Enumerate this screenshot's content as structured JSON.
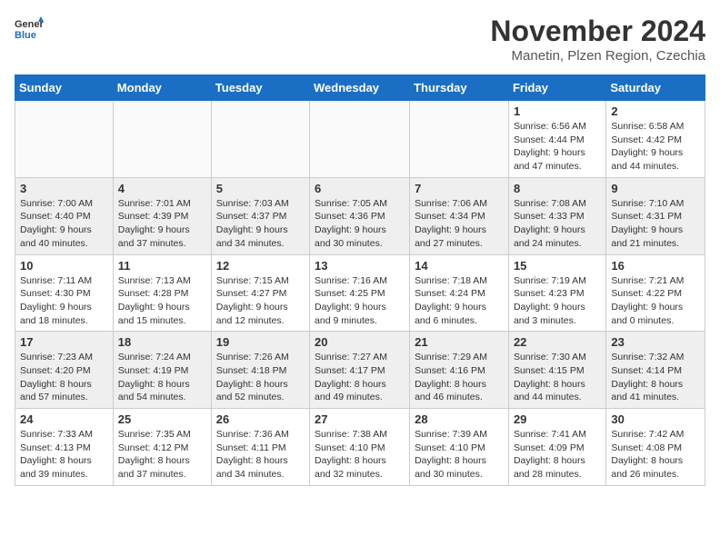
{
  "header": {
    "logo_line1": "General",
    "logo_line2": "Blue",
    "month_title": "November 2024",
    "subtitle": "Manetin, Plzen Region, Czechia"
  },
  "weekdays": [
    "Sunday",
    "Monday",
    "Tuesday",
    "Wednesday",
    "Thursday",
    "Friday",
    "Saturday"
  ],
  "weeks": [
    [
      {
        "day": "",
        "info": ""
      },
      {
        "day": "",
        "info": ""
      },
      {
        "day": "",
        "info": ""
      },
      {
        "day": "",
        "info": ""
      },
      {
        "day": "",
        "info": ""
      },
      {
        "day": "1",
        "info": "Sunrise: 6:56 AM\nSunset: 4:44 PM\nDaylight: 9 hours\nand 47 minutes."
      },
      {
        "day": "2",
        "info": "Sunrise: 6:58 AM\nSunset: 4:42 PM\nDaylight: 9 hours\nand 44 minutes."
      }
    ],
    [
      {
        "day": "3",
        "info": "Sunrise: 7:00 AM\nSunset: 4:40 PM\nDaylight: 9 hours\nand 40 minutes."
      },
      {
        "day": "4",
        "info": "Sunrise: 7:01 AM\nSunset: 4:39 PM\nDaylight: 9 hours\nand 37 minutes."
      },
      {
        "day": "5",
        "info": "Sunrise: 7:03 AM\nSunset: 4:37 PM\nDaylight: 9 hours\nand 34 minutes."
      },
      {
        "day": "6",
        "info": "Sunrise: 7:05 AM\nSunset: 4:36 PM\nDaylight: 9 hours\nand 30 minutes."
      },
      {
        "day": "7",
        "info": "Sunrise: 7:06 AM\nSunset: 4:34 PM\nDaylight: 9 hours\nand 27 minutes."
      },
      {
        "day": "8",
        "info": "Sunrise: 7:08 AM\nSunset: 4:33 PM\nDaylight: 9 hours\nand 24 minutes."
      },
      {
        "day": "9",
        "info": "Sunrise: 7:10 AM\nSunset: 4:31 PM\nDaylight: 9 hours\nand 21 minutes."
      }
    ],
    [
      {
        "day": "10",
        "info": "Sunrise: 7:11 AM\nSunset: 4:30 PM\nDaylight: 9 hours\nand 18 minutes."
      },
      {
        "day": "11",
        "info": "Sunrise: 7:13 AM\nSunset: 4:28 PM\nDaylight: 9 hours\nand 15 minutes."
      },
      {
        "day": "12",
        "info": "Sunrise: 7:15 AM\nSunset: 4:27 PM\nDaylight: 9 hours\nand 12 minutes."
      },
      {
        "day": "13",
        "info": "Sunrise: 7:16 AM\nSunset: 4:25 PM\nDaylight: 9 hours\nand 9 minutes."
      },
      {
        "day": "14",
        "info": "Sunrise: 7:18 AM\nSunset: 4:24 PM\nDaylight: 9 hours\nand 6 minutes."
      },
      {
        "day": "15",
        "info": "Sunrise: 7:19 AM\nSunset: 4:23 PM\nDaylight: 9 hours\nand 3 minutes."
      },
      {
        "day": "16",
        "info": "Sunrise: 7:21 AM\nSunset: 4:22 PM\nDaylight: 9 hours\nand 0 minutes."
      }
    ],
    [
      {
        "day": "17",
        "info": "Sunrise: 7:23 AM\nSunset: 4:20 PM\nDaylight: 8 hours\nand 57 minutes."
      },
      {
        "day": "18",
        "info": "Sunrise: 7:24 AM\nSunset: 4:19 PM\nDaylight: 8 hours\nand 54 minutes."
      },
      {
        "day": "19",
        "info": "Sunrise: 7:26 AM\nSunset: 4:18 PM\nDaylight: 8 hours\nand 52 minutes."
      },
      {
        "day": "20",
        "info": "Sunrise: 7:27 AM\nSunset: 4:17 PM\nDaylight: 8 hours\nand 49 minutes."
      },
      {
        "day": "21",
        "info": "Sunrise: 7:29 AM\nSunset: 4:16 PM\nDaylight: 8 hours\nand 46 minutes."
      },
      {
        "day": "22",
        "info": "Sunrise: 7:30 AM\nSunset: 4:15 PM\nDaylight: 8 hours\nand 44 minutes."
      },
      {
        "day": "23",
        "info": "Sunrise: 7:32 AM\nSunset: 4:14 PM\nDaylight: 8 hours\nand 41 minutes."
      }
    ],
    [
      {
        "day": "24",
        "info": "Sunrise: 7:33 AM\nSunset: 4:13 PM\nDaylight: 8 hours\nand 39 minutes."
      },
      {
        "day": "25",
        "info": "Sunrise: 7:35 AM\nSunset: 4:12 PM\nDaylight: 8 hours\nand 37 minutes."
      },
      {
        "day": "26",
        "info": "Sunrise: 7:36 AM\nSunset: 4:11 PM\nDaylight: 8 hours\nand 34 minutes."
      },
      {
        "day": "27",
        "info": "Sunrise: 7:38 AM\nSunset: 4:10 PM\nDaylight: 8 hours\nand 32 minutes."
      },
      {
        "day": "28",
        "info": "Sunrise: 7:39 AM\nSunset: 4:10 PM\nDaylight: 8 hours\nand 30 minutes."
      },
      {
        "day": "29",
        "info": "Sunrise: 7:41 AM\nSunset: 4:09 PM\nDaylight: 8 hours\nand 28 minutes."
      },
      {
        "day": "30",
        "info": "Sunrise: 7:42 AM\nSunset: 4:08 PM\nDaylight: 8 hours\nand 26 minutes."
      }
    ]
  ]
}
